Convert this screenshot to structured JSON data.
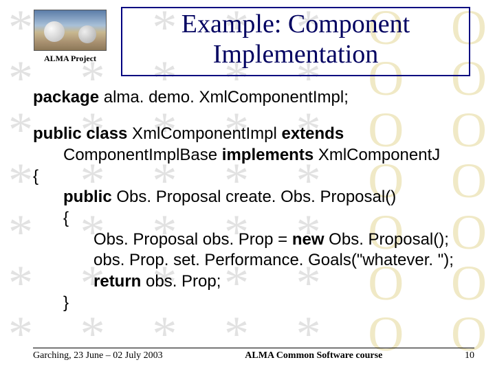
{
  "logo": {
    "caption": "ALMA Project"
  },
  "title": {
    "line1": "Example: Component",
    "line2": "Implementation"
  },
  "code": {
    "kw_package": "package",
    "pkg_name": " alma. demo. XmlComponentImpl;",
    "kw_public_class": "public class",
    "class_name": " XmlComponentImpl ",
    "kw_extends": "extends",
    "extends_clause": " ComponentImplBase ",
    "kw_implements": "implements",
    "impl_name": " XmlComponentJ",
    "open_brace": "{",
    "kw_public": "public",
    "method_sig": " Obs. Proposal create. Obs. Proposal()",
    "method_open": "{",
    "stmt1_a": "Obs. Proposal obs. Prop = ",
    "kw_new": "new",
    "stmt1_b": " Obs. Proposal();",
    "stmt2": "obs. Prop. set. Performance. Goals(\"whatever. \");",
    "kw_return": "return",
    "stmt3": " obs. Prop;",
    "method_close": "}"
  },
  "footer": {
    "left": "Garching, 23 June – 02 July 2003",
    "center": "ALMA Common Software course",
    "right": "10"
  },
  "bg": {
    "star": "*",
    "o": "O",
    "row_stars": 5,
    "row_os": 2,
    "rows": 6
  }
}
